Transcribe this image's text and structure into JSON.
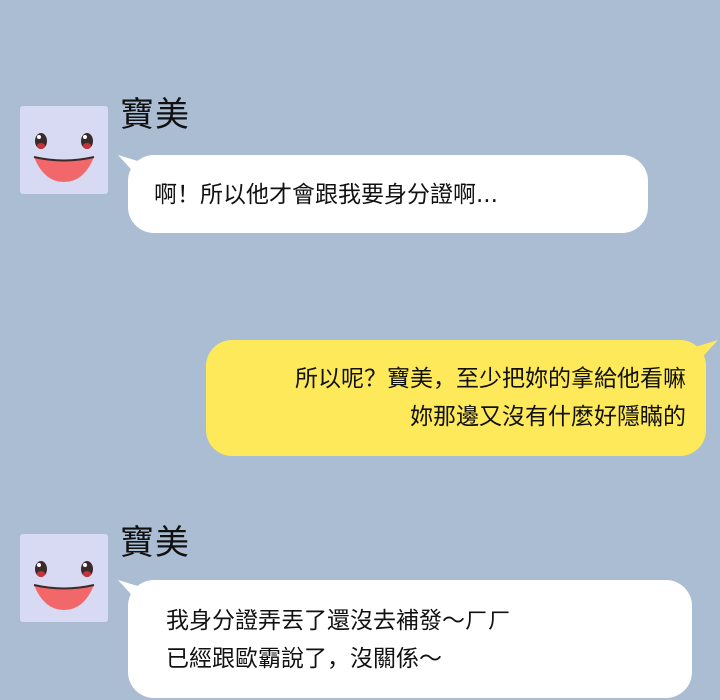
{
  "messages": [
    {
      "sender": "寶美",
      "side": "left",
      "lines": [
        "啊！所以他才會跟我要身分證啊..."
      ]
    },
    {
      "sender": "",
      "side": "right",
      "lines": [
        "所以呢？寶美，至少把妳的拿給他看嘛",
        "妳那邊又沒有什麼好隱瞞的"
      ]
    },
    {
      "sender": "寶美",
      "side": "left",
      "lines": [
        "我身分證弄丟了還沒去補發～ㄏㄏ",
        "已經跟歐霸說了，沒關係～"
      ]
    }
  ],
  "colors": {
    "background": "#abbdd2",
    "incoming_bubble": "#ffffff",
    "outgoing_bubble": "#fde95a",
    "avatar_bg": "#d8daf3"
  },
  "icons": {
    "avatar": "cartoon-face-icon"
  }
}
